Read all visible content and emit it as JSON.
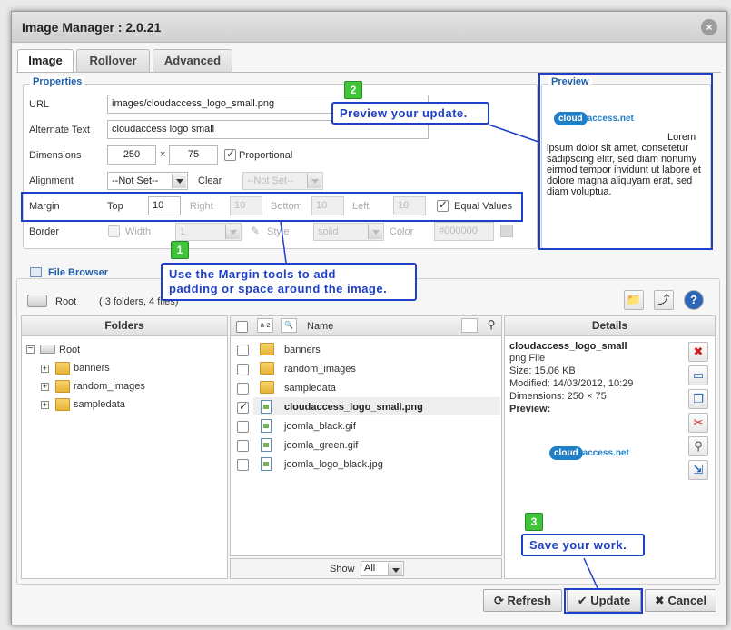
{
  "dialog": {
    "title": "Image Manager : 2.0.21",
    "close_icon": "×"
  },
  "tabs": [
    {
      "label": "Image"
    },
    {
      "label": "Rollover"
    },
    {
      "label": "Advanced"
    }
  ],
  "properties": {
    "legend": "Properties",
    "url_label": "URL",
    "url_value": "images/cloudaccess_logo_small.png",
    "alt_label": "Alternate Text",
    "alt_value": "cloudaccess logo small",
    "dimensions_label": "Dimensions",
    "width_value": "250",
    "times": "×",
    "height_value": "75",
    "proportional_label": "Proportional",
    "alignment_label": "Alignment",
    "alignment_value": "--Not Set--",
    "clear_label": "Clear",
    "clear_value": "--Not Set--",
    "margin_label": "Margin",
    "margin_top_label": "Top",
    "margin_top_value": "10",
    "margin_right_label": "Right",
    "margin_right_value": "10",
    "margin_bottom_label": "Bottom",
    "margin_bottom_value": "10",
    "margin_left_label": "Left",
    "margin_left_value": "10",
    "equal_values_label": "Equal Values",
    "border_label": "Border",
    "border_width_label": "Width",
    "border_width_value": "1",
    "border_style_label": "Style",
    "border_style_value": "solid",
    "border_color_label": "Color",
    "border_color_value": "#000000"
  },
  "preview": {
    "legend": "Preview",
    "logo_cloud": "cloud",
    "logo_rest": "access.net",
    "lorem_first": "Lorem",
    "lorem_text": "ipsum dolor sit amet, consetetur sadipscing elitr, sed diam nonumy eirmod tempor invidunt ut labore et dolore magna aliquyam erat, sed diam voluptua."
  },
  "callouts": {
    "one_badge": "1",
    "one_text_line1": "Use the Margin tools to add",
    "one_text_line2": "padding or space around the image.",
    "two_badge": "2",
    "two_text": "Preview your update.",
    "three_badge": "3",
    "three_text": "Save your work."
  },
  "file_browser": {
    "legend": "File Browser",
    "root_label": "Root",
    "root_info": "( 3 folders, 4 files)",
    "folders_header": "Folders",
    "name_header": "Name",
    "details_header": "Details",
    "tree_root": "Root",
    "tree_items": [
      "banners",
      "random_images",
      "sampledata"
    ],
    "folder_items": [
      "banners",
      "random_images",
      "sampledata"
    ],
    "file_items": [
      "cloudaccess_logo_small.png",
      "joomla_black.gif",
      "joomla_green.gif",
      "joomla_logo_black.jpg"
    ],
    "show_label": "Show",
    "show_value": "All"
  },
  "details": {
    "filename": "cloudaccess_logo_small",
    "type": "png File",
    "size": "Size: 15.06 KB",
    "modified": "Modified: 14/03/2012, 10:29",
    "dimensions": "Dimensions: 250 × 75",
    "preview_label": "Preview:"
  },
  "buttons": {
    "refresh": "Refresh",
    "update": "Update",
    "cancel": "Cancel"
  }
}
